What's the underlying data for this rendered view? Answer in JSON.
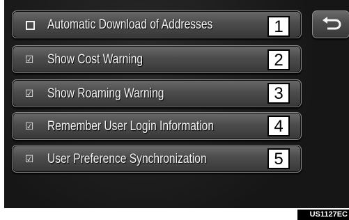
{
  "items": [
    {
      "label": "Automatic Download of Addresses",
      "checked": false,
      "number": "1"
    },
    {
      "label": "Show Cost Warning",
      "checked": true,
      "number": "2"
    },
    {
      "label": "Show Roaming Warning",
      "checked": true,
      "number": "3"
    },
    {
      "label": "Remember User Login Information",
      "checked": true,
      "number": "4"
    },
    {
      "label": "User Preference Synchronization",
      "checked": true,
      "number": "5"
    }
  ],
  "back_button": {
    "icon": "back-arrow-icon"
  },
  "caption": "US1127EC"
}
